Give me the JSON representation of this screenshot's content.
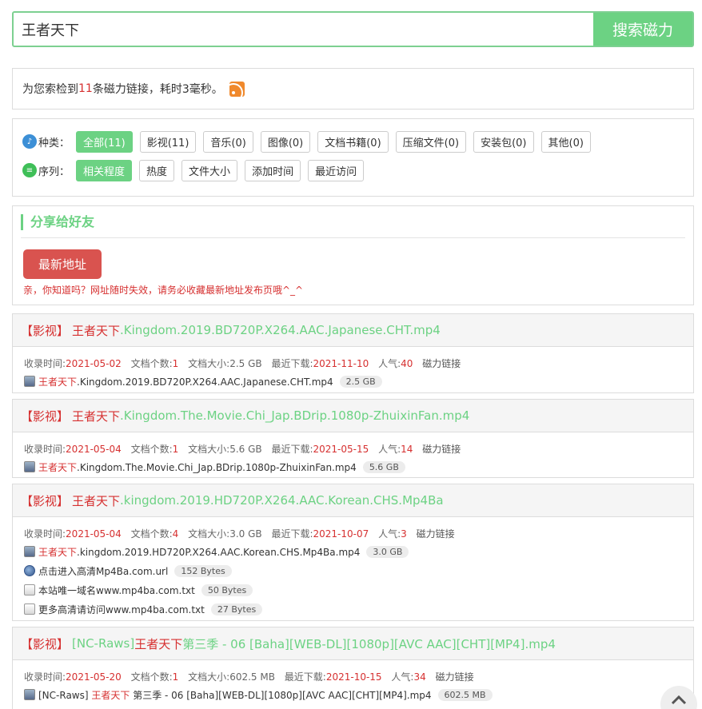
{
  "search": {
    "query": "王者天下",
    "button_label": "搜索磁力"
  },
  "summary": {
    "prefix": "为您索检到",
    "count": "11",
    "suffix": "条磁力链接，耗时3毫秒。"
  },
  "filters": {
    "kind_label": "种类：",
    "kind_options": [
      "全部(11)",
      "影视(11)",
      "音乐(0)",
      "图像(0)",
      "文档书籍(0)",
      "压缩文件(0)",
      "安装包(0)",
      "其他(0)"
    ],
    "sort_label": "序列：",
    "sort_options": [
      "相关程度",
      "热度",
      "文件大小",
      "添加时间",
      "最近访问"
    ]
  },
  "share": {
    "title": "分享给好友",
    "button_label": "最新地址",
    "note": "亲，你知道吗？网址随时失效，请务必收藏最新地址发布页哦^_^"
  },
  "labels": {
    "created": "收录时间:",
    "file_count": "文档个数:",
    "size": "文档大小:",
    "last_download": "最近下载:",
    "popularity": "人气:",
    "magnet": "磁力链接"
  },
  "results": [
    {
      "category": "【影视】",
      "kw": "王者天下",
      "rest": ".Kingdom.2019.BD720P.X264.AAC.Japanese.CHT.mp4",
      "created": "2021-05-02",
      "count": "1",
      "size": "2.5 GB",
      "last": "2021-11-10",
      "pop": "40",
      "files": [
        {
          "kw": "王者天下",
          "name": ".Kingdom.2019.BD720P.X264.AAC.Japanese.CHT.mp4",
          "size": "2.5 GB",
          "icon": "video-file-icon"
        }
      ]
    },
    {
      "category": "【影视】",
      "kw": "王者天下",
      "rest": ".Kingdom.The.Movie.Chi_Jap.BDrip.1080p-ZhuixinFan.mp4",
      "created": "2021-05-04",
      "count": "1",
      "size": "5.6 GB",
      "last": "2021-05-15",
      "pop": "14",
      "files": [
        {
          "kw": "王者天下",
          "name": ".Kingdom.The.Movie.Chi_Jap.BDrip.1080p-ZhuixinFan.mp4",
          "size": "5.6 GB",
          "icon": "video-file-icon"
        }
      ]
    },
    {
      "category": "【影视】",
      "kw": "王者天下",
      "rest": ".kingdom.2019.HD720P.X264.AAC.Korean.CHS.Mp4Ba",
      "created": "2021-05-04",
      "count": "4",
      "size": "3.0 GB",
      "last": "2021-10-07",
      "pop": "3",
      "files": [
        {
          "kw": "王者天下",
          "name": ".kingdom.2019.HD720P.X264.AAC.Korean.CHS.Mp4Ba.mp4",
          "size": "3.0 GB",
          "icon": "video-file-icon"
        },
        {
          "kw": "",
          "name": "点击进入高清Mp4Ba.com.url",
          "size": "152 Bytes",
          "icon": "url-file-icon"
        },
        {
          "kw": "",
          "name": "本站唯一域名www.mp4ba.com.txt",
          "size": "50 Bytes",
          "icon": "text-file-icon"
        },
        {
          "kw": "",
          "name": "更多高清请访问www.mp4ba.com.txt",
          "size": "27 Bytes",
          "icon": "text-file-icon"
        }
      ]
    },
    {
      "category": "【影视】",
      "pre": "[NC-Raws] ",
      "kw": "王者天下",
      "rest": " 第三季 - 06 [Baha][WEB-DL][1080p][AVC AAC][CHT][MP4].mp4",
      "created": "2021-05-20",
      "count": "1",
      "size": "602.5 MB",
      "last": "2021-10-15",
      "pop": "34",
      "files": [
        {
          "pre": "[NC-Raws] ",
          "kw": "王者天下",
          "name": " 第三季 - 06 [Baha][WEB-DL][1080p][AVC AAC][CHT][MP4].mp4",
          "size": "602.5 MB",
          "icon": "video-file-icon"
        }
      ]
    }
  ],
  "scroll_top_icon": "chevron-up-icon"
}
